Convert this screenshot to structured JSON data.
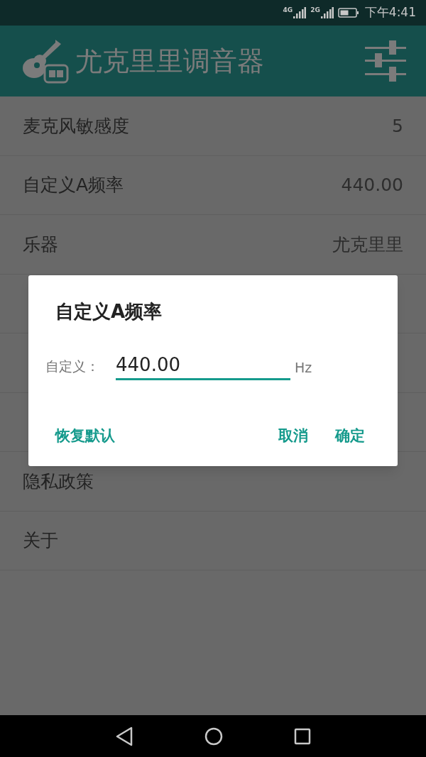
{
  "status_bar": {
    "networks": [
      "4G",
      "2G"
    ],
    "time": "下午4:41"
  },
  "app_bar": {
    "title": "尤克里里调音器"
  },
  "settings": [
    {
      "kind": "setting",
      "label": "麦克风敏感度",
      "value": "5"
    },
    {
      "kind": "setting",
      "label": "自定义A频率",
      "value": "440.00"
    },
    {
      "kind": "setting",
      "label": "乐器",
      "value": "尤克里里"
    },
    {
      "kind": "covered"
    },
    {
      "kind": "covered"
    },
    {
      "kind": "covered"
    },
    {
      "kind": "setting",
      "label": "隐私政策"
    },
    {
      "kind": "setting",
      "label": "关于"
    }
  ],
  "dialog": {
    "title": "自定义A频率",
    "field_label": "自定义：",
    "value": "440.00",
    "unit": "Hz",
    "buttons": [
      {
        "kind": "left",
        "label": "恢复默认"
      },
      {
        "kind": "right",
        "label": "取消"
      },
      {
        "kind": "right",
        "label": "确定"
      }
    ]
  }
}
